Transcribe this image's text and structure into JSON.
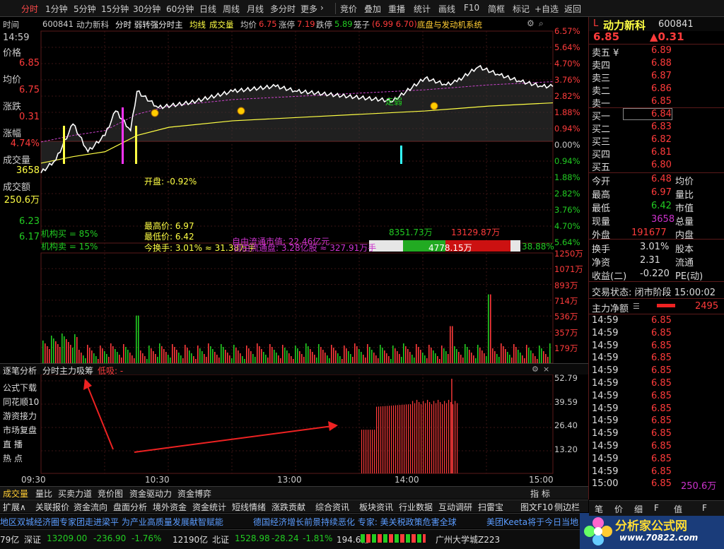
{
  "toolbar": {
    "tabs": [
      "分时",
      "1分钟",
      "5分钟",
      "15分钟",
      "30分钟",
      "60分钟",
      "日线",
      "周线",
      "月线",
      "多分时",
      "更多"
    ],
    "more_arrow": "›",
    "right_buttons": [
      "竞价",
      "叠加",
      "重播",
      "统计",
      "画线",
      "F10",
      "简框",
      "标记",
      "+自选",
      "返回"
    ],
    "window_controls": [
      "–",
      "□",
      "×"
    ]
  },
  "infobar": {
    "time_label": "时间",
    "code": "600841",
    "name": "动力新科",
    "chart_name": "分时 弱转强分时主",
    "avg_line": "均线",
    "volume": "成交量",
    "avg_price_label": "均价",
    "avg_price": "6.75",
    "limit_up_label": "涨停",
    "limit_up": "7.19",
    "limit_down_label": "跌停",
    "limit_down": "5.89",
    "chip_label": "笼子",
    "chip": "(6.99 6.70)",
    "indicator": "底盘与发动机系统"
  },
  "left_info": {
    "time": "14:59",
    "price_label": "价格",
    "price": "6.85",
    "avg_label": "均价",
    "avg": "6.75",
    "change_label": "涨跌",
    "change": "0.31",
    "pct_label": "涨幅",
    "pct": "4.74%",
    "vol_label": "成交量",
    "vol": "3658",
    "amount_label": "成交额",
    "amount": "250.6万",
    "low1": "6.23",
    "low2": "6.17",
    "inst_buy": "机构买 = 85%",
    "inst_sell": "机构卖 = 15%"
  },
  "pct_axis": [
    "6.57%",
    "5.64%",
    "4.70%",
    "3.76%",
    "2.82%",
    "1.88%",
    "0.94%",
    "0.00%",
    "0.94%",
    "1.88%",
    "2.82%",
    "3.76%",
    "4.70%",
    "5.64%"
  ],
  "chart_annotations": {
    "open": "开盘: -0.92%",
    "high": "最高价: 6.97",
    "low": "最低价: 6.42",
    "turnover": "今换手: 3.01% ≈ 31.38万手",
    "float_cap": "自由流通市值: 22.46亿元",
    "float_share": "自由流通盘: 3.28亿股 ≈ 327.91万手",
    "signal": "走弱",
    "inflow": "8351.73万",
    "outflow": "13129.87万",
    "bar_left": "",
    "bar_mid": "4778.15万",
    "bar_right": "38.88%"
  },
  "volume_axis": [
    "1250万",
    "1071万",
    "893万",
    "714万",
    "536万",
    "357万",
    "179万"
  ],
  "sub_panel": {
    "side_top": "逐笔分析",
    "title": "分时主力吸筹",
    "subtitle": "低吸: -",
    "axis": [
      "52.79",
      "39.59",
      "26.40",
      "13.20"
    ],
    "side_items": [
      "公式下载",
      "同花顺10",
      "游资接力",
      "市场复盘",
      "直  播",
      "热  点"
    ]
  },
  "time_axis": [
    "09:30",
    "10:30",
    "13:00",
    "14:00",
    "15:00"
  ],
  "right_panel": {
    "marker": "L",
    "name": "动力新科",
    "code": "600841",
    "price": "6.85",
    "change": "▲0.31",
    "sells": [
      {
        "label": "卖五 ¥",
        "price": "6.89"
      },
      {
        "label": "卖四",
        "price": "6.88"
      },
      {
        "label": "卖三",
        "price": "6.87"
      },
      {
        "label": "卖二",
        "price": "6.86"
      },
      {
        "label": "卖一",
        "price": "6.85"
      }
    ],
    "buys": [
      {
        "label": "买一",
        "price": "6.84"
      },
      {
        "label": "买二",
        "price": "6.83"
      },
      {
        "label": "买三",
        "price": "6.82"
      },
      {
        "label": "买四",
        "price": "6.81"
      },
      {
        "label": "买五",
        "price": "6.80"
      }
    ],
    "stats": [
      {
        "l1": "今开",
        "v1": "6.48",
        "l2": "均价"
      },
      {
        "l1": "最高",
        "v1": "6.97",
        "l2": "量比"
      },
      {
        "l1": "最低",
        "v1": "6.42",
        "l2": "市值"
      },
      {
        "l1": "现量",
        "v1": "3658",
        "l2": "总量"
      },
      {
        "l1": "外盘",
        "v1": "191677",
        "l2": "内盘"
      }
    ],
    "stats2": [
      {
        "l1": "换手",
        "v1": "3.01%",
        "l2": "股本"
      },
      {
        "l1": "净资",
        "v1": "2.31",
        "l2": "流通"
      },
      {
        "l1": "收益(二)",
        "v1": "-0.220",
        "l2": "PE(动)"
      }
    ],
    "trade_status": "交易状态: 闭市阶段 15:00:02",
    "net_label": "主力净额",
    "net_value": "2495",
    "ticks": [
      {
        "t": "14:59",
        "p": "6.85"
      },
      {
        "t": "14:59",
        "p": "6.85"
      },
      {
        "t": "14:59",
        "p": "6.85"
      },
      {
        "t": "14:59",
        "p": "6.85"
      },
      {
        "t": "14:59",
        "p": "6.85"
      },
      {
        "t": "14:59",
        "p": "6.85"
      },
      {
        "t": "14:59",
        "p": "6.85"
      },
      {
        "t": "14:59",
        "p": "6.85"
      },
      {
        "t": "14:59",
        "p": "6.85"
      },
      {
        "t": "14:59",
        "p": "6.85"
      },
      {
        "t": "14:59",
        "p": "6.85"
      },
      {
        "t": "14:59",
        "p": "6.85"
      },
      {
        "t": "14:59",
        "p": "6.85"
      },
      {
        "t": "15:00",
        "p": "6.85",
        "v": "250.6万"
      }
    ],
    "bottom_tabs": [
      "笔",
      "价",
      "细",
      "F",
      "值",
      "F"
    ]
  },
  "bottom_tabs": [
    "成交量",
    "量比",
    "买卖力道",
    "竞价图",
    "资金驱动力",
    "资金博弈"
  ],
  "bottom_right": [
    "指",
    "标"
  ],
  "bottom_tabs2": [
    "扩展∧",
    "关联报价",
    "资金流向",
    "盘面分析",
    "境外资金",
    "资金统计",
    "短线情绪",
    "涨跌贡献",
    "综合资讯",
    "板块资讯",
    "行业数据",
    "互动调研",
    "扫雷宝",
    "图文F10",
    "侧边栏"
  ],
  "ticker": [
    "地区双城经济圈专家团走进梁平 为产业高质量发展献智赋能",
    "德国经济增长前景持续恶化 专家: 美关税政策危害全球",
    "美团Keeta将于今日当地"
  ],
  "statusbar": {
    "left_val": "79亿",
    "sz_label": "深证",
    "sz_val": "13209.00",
    "sz_chg": "-236.90",
    "sz_pct": "-1.76%",
    "sz_amt": "12190亿",
    "bz_label": "北证",
    "bz_val": "1528.98",
    "bz_chg": "-28.24",
    "bz_pct": "-1.81%",
    "bz_amt": "194.6亿",
    "location": "广州大学城Z223"
  },
  "logo": {
    "title": "分析家公式网",
    "url": "www.70822.com"
  },
  "colors": {
    "up": "#ff3b3b",
    "down": "#22cc22",
    "yellow": "#ffff44",
    "price_line": "#ffffff",
    "avg_line": "#ffff44",
    "magenta": "#ff33ff",
    "cyan": "#33ffff"
  },
  "chart_data": {
    "type": "line",
    "price_y_range": [
      5.89,
      7.19
    ],
    "series": [
      {
        "name": "价格",
        "x": [
          "09:30",
          "09:37",
          "09:45",
          "09:52",
          "10:00",
          "10:05",
          "10:12",
          "10:15",
          "10:25",
          "10:40",
          "11:00",
          "11:20",
          "13:00",
          "13:30",
          "13:45",
          "14:00",
          "14:10",
          "14:15",
          "14:25",
          "14:35",
          "14:45",
          "14:55",
          "15:00"
        ],
        "values": [
          6.32,
          6.4,
          6.62,
          6.45,
          6.55,
          6.7,
          6.58,
          6.82,
          6.72,
          6.75,
          6.82,
          6.85,
          6.82,
          6.78,
          6.76,
          6.9,
          6.86,
          6.88,
          6.97,
          6.92,
          6.88,
          6.85,
          6.85
        ]
      },
      {
        "name": "均价",
        "x": [
          "09:30",
          "09:45",
          "10:00",
          "10:15",
          "10:30",
          "11:00",
          "13:00",
          "14:00",
          "14:30",
          "15:00"
        ],
        "values": [
          6.38,
          6.42,
          6.45,
          6.55,
          6.6,
          6.64,
          6.66,
          6.7,
          6.73,
          6.75
        ]
      }
    ],
    "volume_y_range": [
      0,
      1250
    ],
    "volume_peaks": [
      {
        "time": "10:15",
        "value": 540
      },
      {
        "time": "14:12",
        "value": 420
      },
      {
        "time": "14:30",
        "value": 780
      }
    ],
    "sub_y_range": [
      0,
      52.79
    ],
    "sub_bars_time_range": [
      "13:30",
      "14:15"
    ]
  }
}
